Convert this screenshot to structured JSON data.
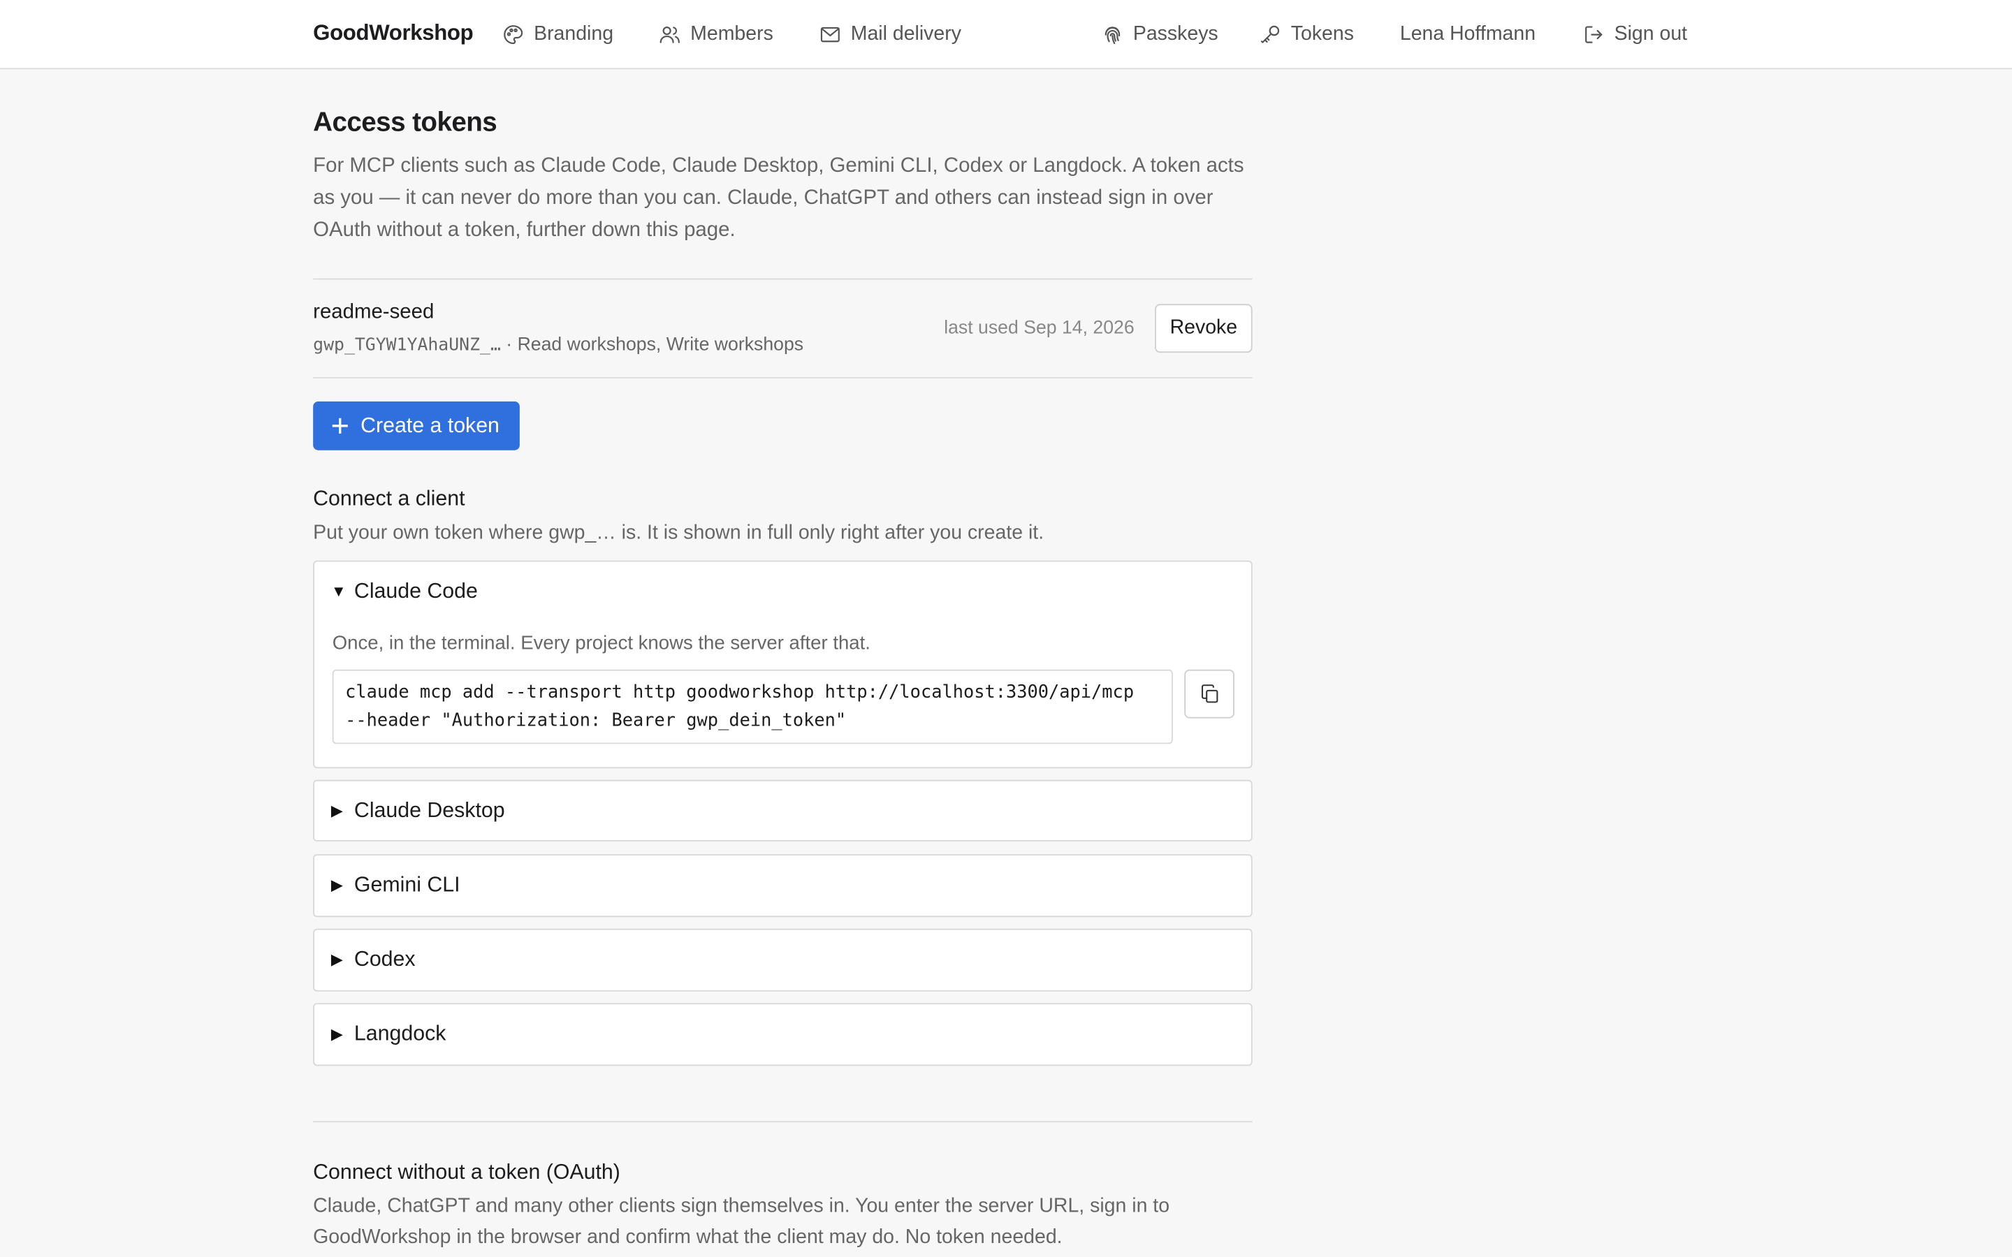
{
  "nav": {
    "brand": "GoodWorkshop",
    "left": [
      {
        "label": "Branding",
        "icon": "palette-icon"
      },
      {
        "label": "Members",
        "icon": "users-icon"
      },
      {
        "label": "Mail delivery",
        "icon": "mail-icon"
      }
    ],
    "right": [
      {
        "label": "Passkeys",
        "icon": "fingerprint-icon"
      },
      {
        "label": "Tokens",
        "icon": "key-icon"
      },
      {
        "label": "Lena Hoffmann"
      },
      {
        "label": "Sign out",
        "icon": "sign-out-icon"
      }
    ]
  },
  "page": {
    "title": "Access tokens",
    "intro": "For MCP clients such as Claude Code, Claude Desktop, Gemini CLI, Codex or Langdock. A token acts as you — it can never do more than you can. Claude, ChatGPT and others can instead sign in over OAuth without a token, further down this page."
  },
  "token": {
    "name": "readme-seed",
    "prefix": "gwp_TGYW1YAhaUNZ_…",
    "scopes": " · Read workshops, Write workshops",
    "last_used": "last used Sep 14, 2026",
    "revoke_label": "Revoke"
  },
  "create_label": "Create a token",
  "connect": {
    "title": "Connect a client",
    "subtitle": "Put your own token where gwp_… is. It is shown in full only right after you create it.",
    "clients": [
      {
        "name": "Claude Code",
        "expanded": true,
        "description": "Once, in the terminal. Every project knows the server after that.",
        "command_line1": "claude mcp add --transport http goodworkshop http://localhost:3300/api/mcp",
        "command_line2": "--header \"Authorization: Bearer gwp_dein_token\""
      },
      {
        "name": "Claude Desktop",
        "expanded": false
      },
      {
        "name": "Gemini CLI",
        "expanded": false
      },
      {
        "name": "Codex",
        "expanded": false
      },
      {
        "name": "Langdock",
        "expanded": false
      }
    ]
  },
  "oauth": {
    "title": "Connect without a token (OAuth)",
    "text": "Claude, ChatGPT and many other clients sign themselves in. You enter the server URL, sign in to GoodWorkshop in the browser and confirm what the client may do. No token needed."
  },
  "colors": {
    "primary": "#2f6fde",
    "background": "#f7f7f7",
    "border": "#d8d8d8"
  }
}
